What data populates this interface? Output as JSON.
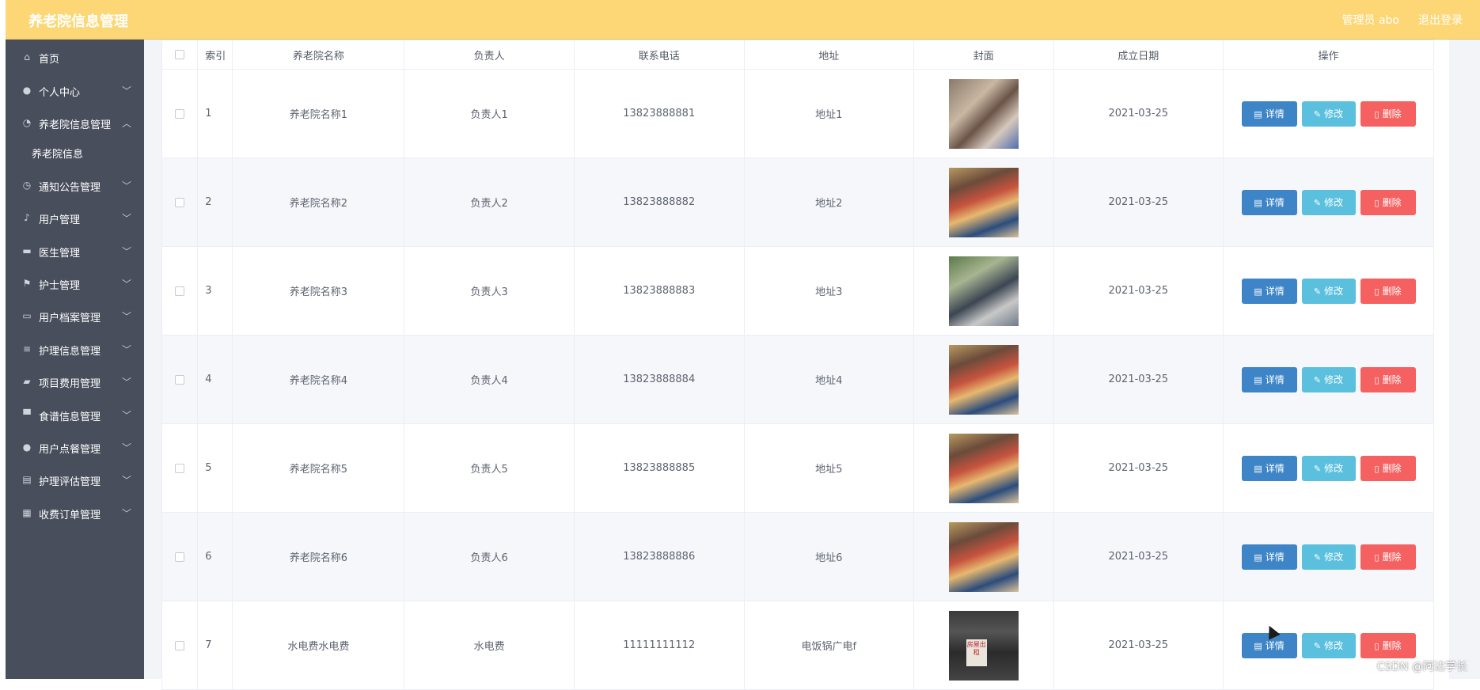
{
  "header": {
    "brand": "养老院信息管理",
    "user": "管理员 abo",
    "logout": "退出登录"
  },
  "sidebar": {
    "items": [
      {
        "label": "首页",
        "icon": "home-icon",
        "glyph": "⌂",
        "chevron": false
      },
      {
        "label": "个人中心",
        "icon": "user-icon",
        "glyph": "●",
        "chevron": true
      },
      {
        "label": "养老院信息管理",
        "icon": "bell-off-icon",
        "glyph": "◔",
        "chevron": true,
        "expanded": true
      },
      {
        "label": "通知公告管理",
        "icon": "clock-icon",
        "glyph": "◷",
        "chevron": true
      },
      {
        "label": "用户管理",
        "icon": "microphone-icon",
        "glyph": "♪",
        "chevron": true
      },
      {
        "label": "医生管理",
        "icon": "message-icon",
        "glyph": "▬",
        "chevron": true
      },
      {
        "label": "护士管理",
        "icon": "flag-icon",
        "glyph": "⚑",
        "chevron": true
      },
      {
        "label": "用户档案管理",
        "icon": "chat-icon",
        "glyph": "▭",
        "chevron": true
      },
      {
        "label": "护理信息管理",
        "icon": "list-icon",
        "glyph": "≡",
        "chevron": true
      },
      {
        "label": "项目费用管理",
        "icon": "ticket-icon",
        "glyph": "▰",
        "chevron": true
      },
      {
        "label": "食谱信息管理",
        "icon": "monitor-icon",
        "glyph": "▀",
        "chevron": true
      },
      {
        "label": "用户点餐管理",
        "icon": "user-icon",
        "glyph": "●",
        "chevron": true
      },
      {
        "label": "护理评估管理",
        "icon": "document-icon",
        "glyph": "▤",
        "chevron": true
      },
      {
        "label": "收费订单管理",
        "icon": "grid-icon",
        "glyph": "▦",
        "chevron": true
      }
    ],
    "subitem": "养老院信息"
  },
  "table": {
    "headers": [
      "",
      "索引",
      "养老院名称",
      "负责人",
      "联系电话",
      "地址",
      "封面",
      "成立日期",
      "操作"
    ],
    "rows": [
      {
        "index": "1",
        "name": "养老院名称1",
        "manager": "负责人1",
        "phone": "13823888881",
        "address": "地址1",
        "date": "2021-03-25",
        "cover": "c1"
      },
      {
        "index": "2",
        "name": "养老院名称2",
        "manager": "负责人2",
        "phone": "13823888882",
        "address": "地址2",
        "date": "2021-03-25",
        "cover": "c2"
      },
      {
        "index": "3",
        "name": "养老院名称3",
        "manager": "负责人3",
        "phone": "13823888883",
        "address": "地址3",
        "date": "2021-03-25",
        "cover": "c3"
      },
      {
        "index": "4",
        "name": "养老院名称4",
        "manager": "负责人4",
        "phone": "13823888884",
        "address": "地址4",
        "date": "2021-03-25",
        "cover": "c2"
      },
      {
        "index": "5",
        "name": "养老院名称5",
        "manager": "负责人5",
        "phone": "13823888885",
        "address": "地址5",
        "date": "2021-03-25",
        "cover": "c2"
      },
      {
        "index": "6",
        "name": "养老院名称6",
        "manager": "负责人6",
        "phone": "13823888886",
        "address": "地址6",
        "date": "2021-03-25",
        "cover": "c2"
      },
      {
        "index": "7",
        "name": "水电费水电费",
        "manager": "水电费",
        "phone": "11111111112",
        "address": "电饭锅广电f",
        "date": "2021-03-25",
        "cover": "c7"
      }
    ],
    "actions": {
      "detail": "详情",
      "edit": "修改",
      "delete": "删除"
    },
    "cover_sign_text": "房屋出租"
  },
  "watermark": "CSDN @阿达学长",
  "colors": {
    "header_bg": "#fdd775",
    "sidebar_bg": "#484e5c",
    "detail_btn": "#3d85c6",
    "edit_btn": "#5bc0de",
    "delete_btn": "#f56161"
  }
}
